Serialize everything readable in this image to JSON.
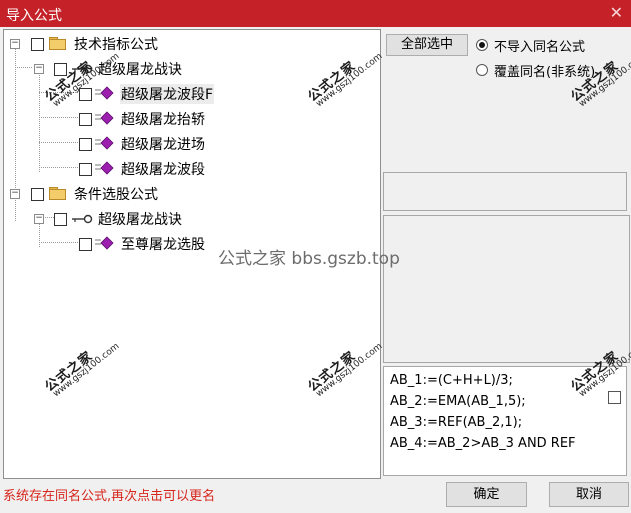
{
  "window": {
    "title": "导入公式",
    "close_glyph": "✕"
  },
  "tree": [
    {
      "label": "技术指标公式",
      "icon": "folder-icon",
      "expander": "−"
    },
    {
      "label": "超级屠龙战诀",
      "icon": "key-icon",
      "expander": "−"
    },
    {
      "label": "超级屠龙波段F",
      "icon": "diamond-formula-icon",
      "selected": true
    },
    {
      "label": "超级屠龙抬轿",
      "icon": "diamond-formula-icon"
    },
    {
      "label": "超级屠龙进场",
      "icon": "diamond-formula-icon"
    },
    {
      "label": "超级屠龙波段",
      "icon": "diamond-formula-icon"
    },
    {
      "label": "条件选股公式",
      "icon": "folder-icon",
      "expander": "−"
    },
    {
      "label": "超级屠龙战诀",
      "icon": "key-icon",
      "expander": "−"
    },
    {
      "label": "至尊屠龙选股",
      "icon": "diamond-formula-icon"
    }
  ],
  "options": {
    "select_all_label": "全部选中",
    "radio_skip_label": "不导入同名公式",
    "radio_overwrite_label": "覆盖同名(非系统)",
    "selected_radio": "skip"
  },
  "code_preview": {
    "lines": [
      "AB_1:=(C+H+L)/3;",
      "AB_2:=EMA(AB_1,5);",
      "AB_3:=REF(AB_2,1);",
      "AB_4:=AB_2>AB_3 AND REF"
    ]
  },
  "status_text": "系统存在同名公式,再次点击可以更名",
  "buttons": {
    "ok": "确定",
    "cancel": "取消"
  },
  "watermark": {
    "center_text": "公式之家 bbs.gszb.top",
    "stamp_cn": "公式之家",
    "stamp_url": "www.gszj100.com"
  },
  "colors": {
    "titlebar": "#c42128",
    "status": "#d7251b",
    "diamond": "#9c1fb0"
  }
}
